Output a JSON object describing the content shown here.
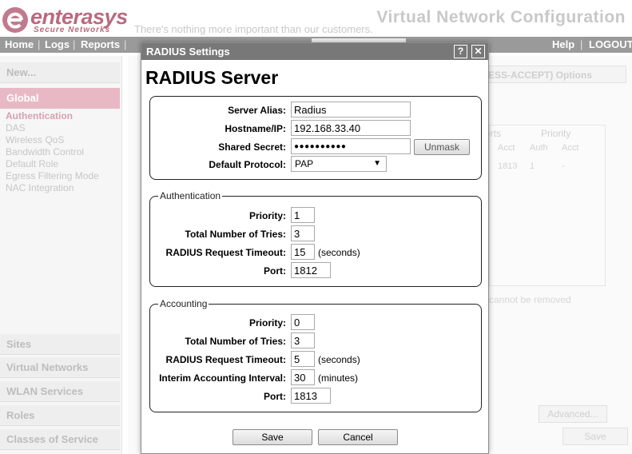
{
  "header": {
    "logo_text": "enterasys",
    "logo_sub": "Secure Networks",
    "tagline": "There's nothing more important than our customers.",
    "app_title": "Virtual Network Configuration"
  },
  "nav": {
    "home": "Home",
    "logs": "Logs",
    "reports": "Reports",
    "help": "Help",
    "logout": "LOGOUT"
  },
  "sidebar": {
    "new": "New...",
    "global": "Global",
    "sub_items": [
      "Authentication",
      "DAS",
      "Wireless QoS",
      "Bandwidth Control",
      "Default Role",
      "Egress Filtering Mode",
      "NAC Integration"
    ],
    "sections": [
      "Sites",
      "Virtual Networks",
      "WLAN Services",
      "Roles",
      "Classes of Service"
    ]
  },
  "background": {
    "options_header": "ESS-ACCEPT) Options",
    "col_ports": "orts",
    "col_priority": "Priority",
    "col_acct": "Acct",
    "col_auth": "Auth",
    "col_acct2": "Acct",
    "row_port": "1813",
    "row_auth": "1",
    "row_acct": "-",
    "cannot_removed": "cannot be removed",
    "advanced": "Advanced...",
    "save": "Save"
  },
  "dialog": {
    "title": "RADIUS Settings",
    "help_btn": "?",
    "close_btn": "✕",
    "heading": "RADIUS Server",
    "server": {
      "alias_label": "Server Alias:",
      "alias_value": "Radius",
      "hostname_label": "Hostname/IP:",
      "hostname_value": "192.168.33.40",
      "secret_label": "Shared Secret:",
      "secret_value": "●●●●●●●●●●",
      "unmask": "Unmask",
      "protocol_label": "Default Protocol:",
      "protocol_value": "PAP"
    },
    "authentication": {
      "legend": "Authentication",
      "priority_label": "Priority:",
      "priority_value": "1",
      "tries_label": "Total Number of Tries:",
      "tries_value": "3",
      "timeout_label": "RADIUS Request Timeout:",
      "timeout_value": "15",
      "timeout_unit": "(seconds)",
      "port_label": "Port:",
      "port_value": "1812"
    },
    "accounting": {
      "legend": "Accounting",
      "priority_label": "Priority:",
      "priority_value": "0",
      "tries_label": "Total Number of Tries:",
      "tries_value": "3",
      "timeout_label": "RADIUS Request Timeout:",
      "timeout_value": "5",
      "timeout_unit": "(seconds)",
      "interim_label": "Interim Accounting Interval:",
      "interim_value": "30",
      "interim_unit": "(minutes)",
      "port_label": "Port:",
      "port_value": "1813"
    },
    "save": "Save",
    "cancel": "Cancel"
  }
}
